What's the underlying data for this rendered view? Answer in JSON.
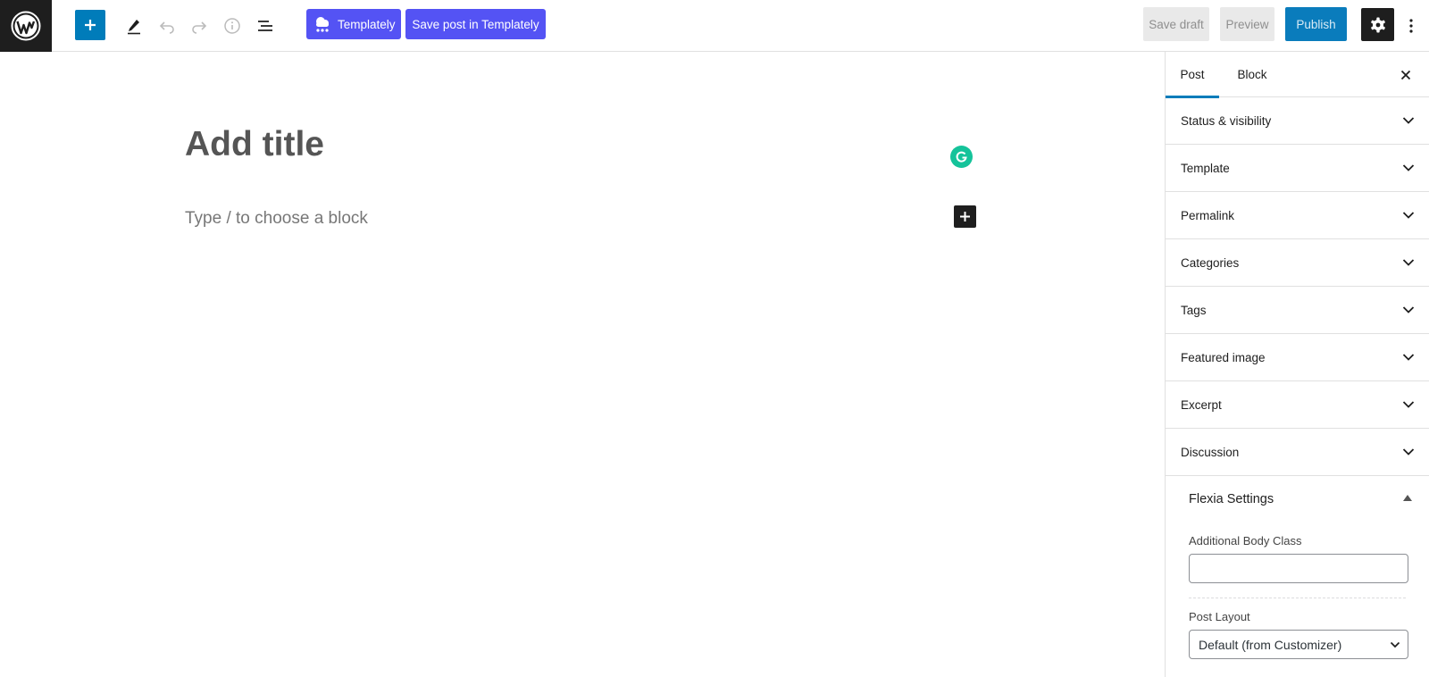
{
  "toolbar": {
    "templately_label": "Templately",
    "save_templately_label": "Save post in Templately",
    "save_draft_label": "Save draft",
    "preview_label": "Preview",
    "publish_label": "Publish"
  },
  "editor": {
    "title_placeholder": "Add title",
    "block_placeholder": "Type / to choose a block"
  },
  "sidebar": {
    "tabs": [
      {
        "label": "Post",
        "active": true
      },
      {
        "label": "Block",
        "active": false
      }
    ],
    "panels": [
      {
        "label": "Status & visibility"
      },
      {
        "label": "Template"
      },
      {
        "label": "Permalink"
      },
      {
        "label": "Categories"
      },
      {
        "label": "Tags"
      },
      {
        "label": "Featured image"
      },
      {
        "label": "Excerpt"
      },
      {
        "label": "Discussion"
      }
    ],
    "flexia": {
      "title": "Flexia Settings",
      "body_class_label": "Additional Body Class",
      "body_class_value": "",
      "post_layout_label": "Post Layout",
      "post_layout_value": "Default (from Customizer)"
    }
  },
  "colors": {
    "wp_dark": "#1e1e1e",
    "accent_blue": "#007cba",
    "templately_purple": "#5453f4",
    "grammarly_green": "#15c39a"
  },
  "icons": [
    "wordpress-logo-icon",
    "plus-icon",
    "pencil-icon",
    "undo-icon",
    "redo-icon",
    "info-icon",
    "list-view-icon",
    "templately-cloud-icon",
    "gear-icon",
    "more-vertical-icon",
    "close-icon",
    "chevron-down-icon",
    "grammarly-icon",
    "triangle-up-icon"
  ]
}
